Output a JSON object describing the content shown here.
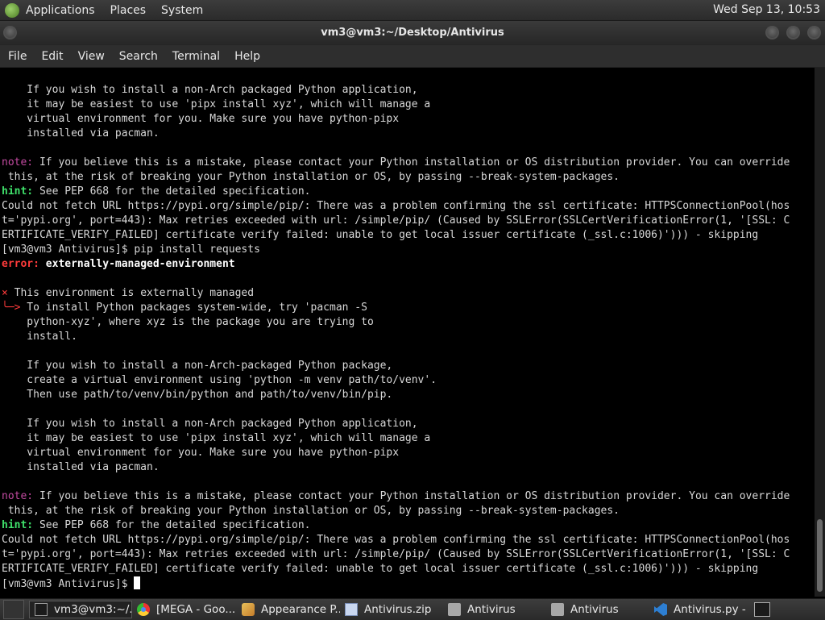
{
  "top_panel": {
    "menus": [
      "Applications",
      "Places",
      "System"
    ],
    "clock": "Wed Sep 13, 10:53"
  },
  "window": {
    "title": "vm3@vm3:~/Desktop/Antivirus"
  },
  "menu_bar": [
    "File",
    "Edit",
    "View",
    "Search",
    "Terminal",
    "Help"
  ],
  "terminal": {
    "lines": [
      "    If you wish to install a non-Arch packaged Python application,",
      "    it may be easiest to use 'pipx install xyz', which will manage a",
      "    virtual environment for you. Make sure you have python-pipx",
      "    installed via pacman.",
      "",
      "note: If you believe this is a mistake, please contact your Python installation or OS distribution provider. You can override",
      " this, at the risk of breaking your Python installation or OS, by passing --break-system-packages.",
      "hint: See PEP 668 for the detailed specification.",
      "Could not fetch URL https://pypi.org/simple/pip/: There was a problem confirming the ssl certificate: HTTPSConnectionPool(hos",
      "t='pypi.org', port=443): Max retries exceeded with url: /simple/pip/ (Caused by SSLError(SSLCertVerificationError(1, '[SSL: C",
      "ERTIFICATE_VERIFY_FAILED] certificate verify failed: unable to get local issuer certificate (_ssl.c:1006)'))) - skipping",
      "[vm3@vm3 Antivirus]$ pip install requests",
      "error: externally-managed-environment",
      "",
      "× This environment is externally managed",
      "╰─> To install Python packages system-wide, try 'pacman -S",
      "    python-xyz', where xyz is the package you are trying to",
      "    install.",
      "",
      "    If you wish to install a non-Arch-packaged Python package,",
      "    create a virtual environment using 'python -m venv path/to/venv'.",
      "    Then use path/to/venv/bin/python and path/to/venv/bin/pip.",
      "",
      "    If you wish to install a non-Arch packaged Python application,",
      "    it may be easiest to use 'pipx install xyz', which will manage a",
      "    virtual environment for you. Make sure you have python-pipx",
      "    installed via pacman.",
      "",
      "note: If you believe this is a mistake, please contact your Python installation or OS distribution provider. You can override",
      " this, at the risk of breaking your Python installation or OS, by passing --break-system-packages.",
      "hint: See PEP 668 for the detailed specification.",
      "Could not fetch URL https://pypi.org/simple/pip/: There was a problem confirming the ssl certificate: HTTPSConnectionPool(hos",
      "t='pypi.org', port=443): Max retries exceeded with url: /simple/pip/ (Caused by SSLError(SSLCertVerificationError(1, '[SSL: C",
      "ERTIFICATE_VERIFY_FAILED] certificate verify failed: unable to get local issuer certificate (_ssl.c:1006)'))) - skipping",
      "[vm3@vm3 Antivirus]$ "
    ],
    "colors": {
      "error_red": "#ff3b3b",
      "hint_green": "#3fe06a",
      "note_magenta": "#c24aa0",
      "text": "#d8d8d8"
    }
  },
  "taskbar": {
    "tasks": [
      {
        "label": "vm3@vm3:~/...",
        "icon": "terminal-icon"
      },
      {
        "label": "[MEGA - Goo...",
        "icon": "chrome-icon"
      },
      {
        "label": "Appearance P...",
        "icon": "appearance-icon"
      },
      {
        "label": "Antivirus.zip",
        "icon": "archive-icon"
      },
      {
        "label": "Antivirus",
        "icon": "folder-icon"
      },
      {
        "label": "Antivirus",
        "icon": "folder-icon"
      },
      {
        "label": "Antivirus.py - ...",
        "icon": "vscode-icon"
      }
    ]
  }
}
